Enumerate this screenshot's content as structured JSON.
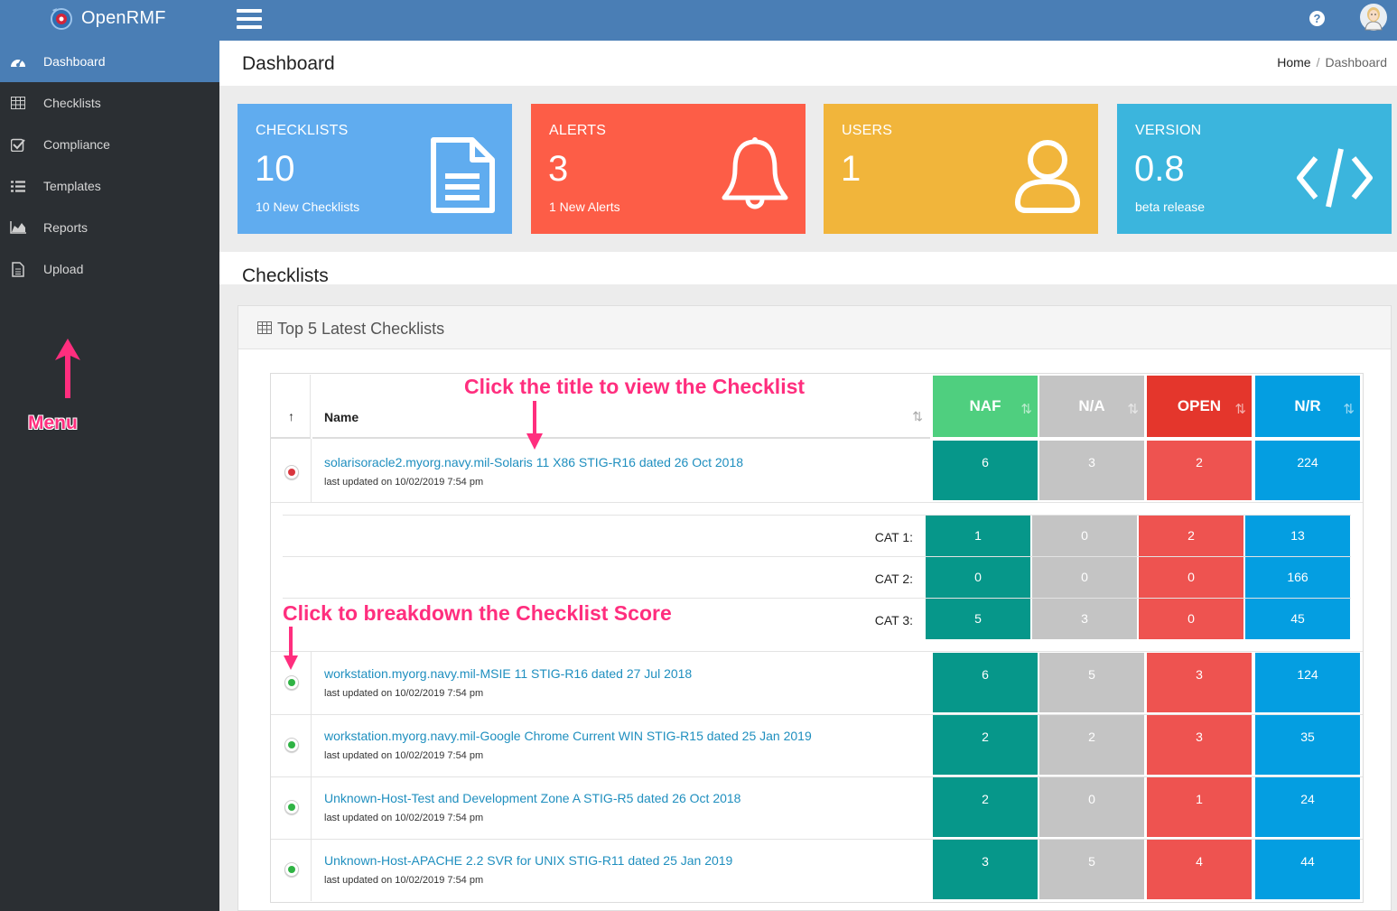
{
  "app": {
    "name": "OpenRMF"
  },
  "colors": {
    "topbar": "#4a7eb5",
    "sidebar": "#2b2f33",
    "checklists_box": "#60acef",
    "alerts_box": "#fd5d47",
    "users_box": "#f1b53b",
    "version_box": "#3bb5dd",
    "naf": "#06978a",
    "na": "#c4c4c4",
    "open": "#ee5350",
    "nr": "#049ee1",
    "annotation": "#ff2e7e"
  },
  "sidebar": {
    "items": [
      {
        "label": "Dashboard",
        "icon": "dashboard-icon",
        "active": true
      },
      {
        "label": "Checklists",
        "icon": "table-icon",
        "active": false
      },
      {
        "label": "Compliance",
        "icon": "check-square-icon",
        "active": false
      },
      {
        "label": "Templates",
        "icon": "list-icon",
        "active": false
      },
      {
        "label": "Reports",
        "icon": "area-chart-icon",
        "active": false
      },
      {
        "label": "Upload",
        "icon": "file-icon",
        "active": false
      }
    ],
    "annotation": "Menu"
  },
  "page": {
    "title": "Dashboard",
    "breadcrumb": {
      "home": "Home",
      "separator": "/",
      "current": "Dashboard"
    }
  },
  "info_boxes": [
    {
      "title": "CHECKLISTS",
      "value": "10",
      "sub": "10 New Checklists",
      "icon": "document-icon"
    },
    {
      "title": "ALERTS",
      "value": "3",
      "sub": "1 New Alerts",
      "icon": "bell-icon"
    },
    {
      "title": "USERS",
      "value": "1",
      "sub": "",
      "icon": "user-icon"
    },
    {
      "title": "VERSION",
      "value": "0.8",
      "sub": "beta release",
      "icon": "code-icon"
    }
  ],
  "section": {
    "title": "Checklists"
  },
  "card": {
    "title": "Top 5 Latest Checklists"
  },
  "table": {
    "sort_glyph": "↑",
    "name_header": "Name",
    "score_headers": [
      "NAF",
      "N/A",
      "OPEN",
      "N/R"
    ],
    "sort_icon": "⇅",
    "rows": [
      {
        "title": "solarisoracle2.myorg.navy.mil-Solaris 11 X86 STIG-R16 dated 26 Oct 2018",
        "updated": "last updated on 10/02/2019 7:54 pm",
        "scores": [
          "6",
          "3",
          "2",
          "224"
        ],
        "expanded": true
      },
      {
        "title": "workstation.myorg.navy.mil-MSIE 11 STIG-R16 dated 27 Jul 2018",
        "updated": "last updated on 10/02/2019 7:54 pm",
        "scores": [
          "6",
          "5",
          "3",
          "124"
        ],
        "expanded": false
      },
      {
        "title": "workstation.myorg.navy.mil-Google Chrome Current WIN STIG-R15 dated 25 Jan 2019",
        "updated": "last updated on 10/02/2019 7:54 pm",
        "scores": [
          "2",
          "2",
          "3",
          "35"
        ],
        "expanded": false
      },
      {
        "title": "Unknown-Host-Test and Development Zone A STIG-R5 dated 26 Oct 2018",
        "updated": "last updated on 10/02/2019 7:54 pm",
        "scores": [
          "2",
          "0",
          "1",
          "24"
        ],
        "expanded": false
      },
      {
        "title": "Unknown-Host-APACHE 2.2 SVR for UNIX STIG-R11 dated 25 Jan 2019",
        "updated": "last updated on 10/02/2019 7:54 pm",
        "scores": [
          "3",
          "5",
          "4",
          "44"
        ],
        "expanded": false
      }
    ],
    "breakdown": [
      {
        "label": "CAT 1:",
        "scores": [
          "1",
          "0",
          "2",
          "13"
        ]
      },
      {
        "label": "CAT 2:",
        "scores": [
          "0",
          "0",
          "0",
          "166"
        ]
      },
      {
        "label": "CAT 3:",
        "scores": [
          "5",
          "3",
          "0",
          "45"
        ]
      }
    ]
  },
  "annotations": {
    "title_hint": "Click the title to view the Checklist",
    "breakdown_hint": "Click to breakdown the Checklist Score"
  }
}
